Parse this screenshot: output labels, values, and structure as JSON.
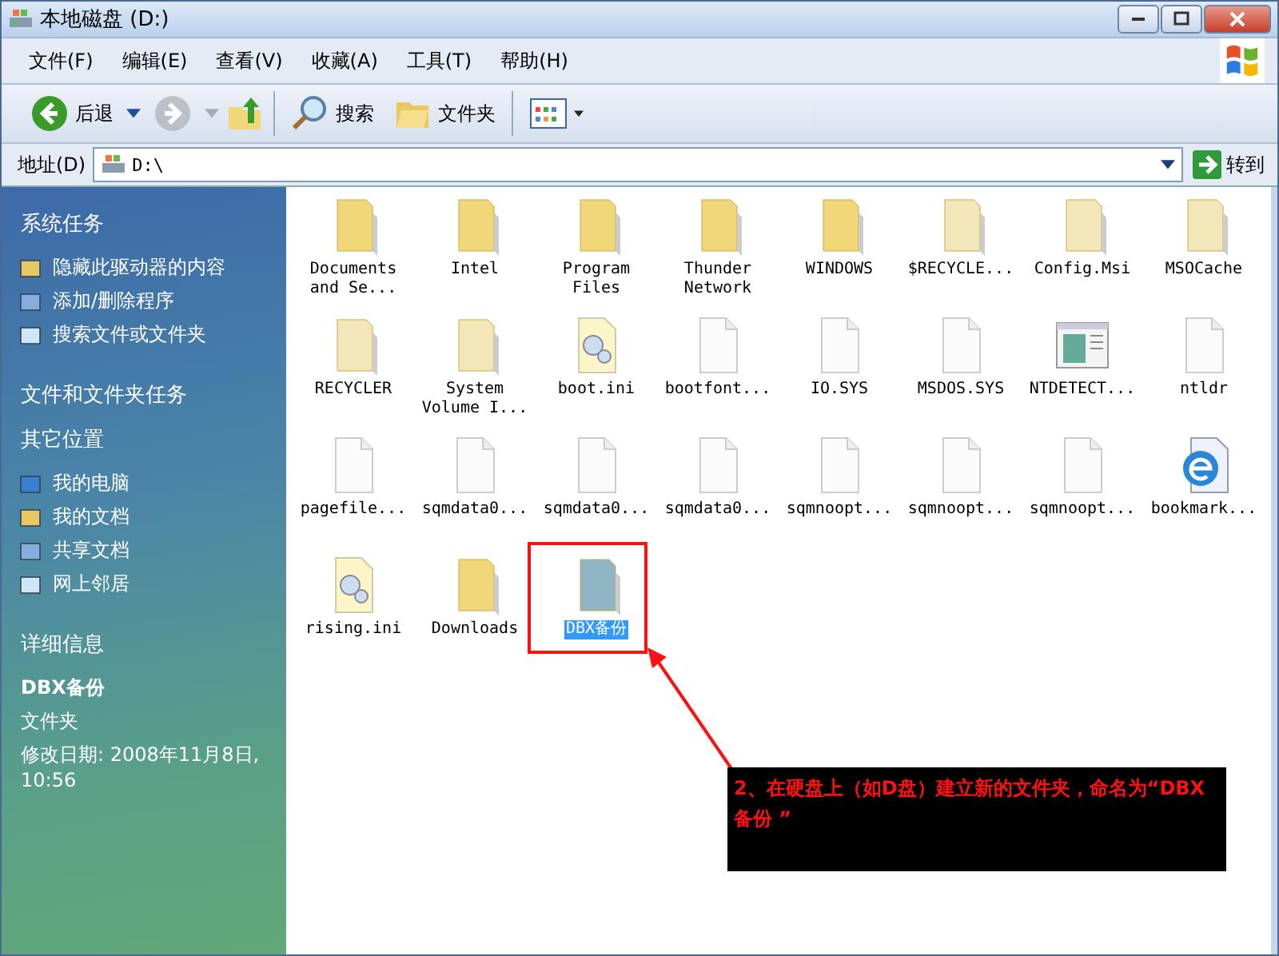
{
  "window": {
    "title": "本地磁盘 (D:)"
  },
  "menu": [
    "文件(F)",
    "编辑(E)",
    "查看(V)",
    "收藏(A)",
    "工具(T)",
    "帮助(H)"
  ],
  "toolbar": {
    "back": "后退",
    "forward_disabled": true,
    "search": "搜索",
    "folders": "文件夹"
  },
  "address": {
    "label": "地址(D)",
    "value": "D:\\",
    "go": "转到"
  },
  "sidebar": {
    "sections": [
      {
        "title": "系统任务",
        "items": [
          "隐藏此驱动器的内容",
          "添加/删除程序",
          "搜索文件或文件夹"
        ]
      },
      {
        "title": "文件和文件夹任务"
      },
      {
        "title": "其它位置",
        "items": [
          "我的电脑",
          "我的文档",
          "共享文档",
          "网上邻居"
        ]
      }
    ],
    "details": {
      "title": "详细信息",
      "name": "DBX备份",
      "type": "文件夹",
      "modified": "修改日期: 2008年11月8日, 10:56"
    }
  },
  "files": [
    {
      "name": "Documents and Se...",
      "kind": "folder",
      "hidden": false,
      "selected": false
    },
    {
      "name": "Intel",
      "kind": "folder",
      "hidden": false,
      "selected": false
    },
    {
      "name": "Program Files",
      "kind": "folder",
      "hidden": false,
      "selected": false
    },
    {
      "name": "Thunder Network",
      "kind": "folder",
      "hidden": false,
      "selected": false
    },
    {
      "name": "WINDOWS",
      "kind": "folder",
      "hidden": false,
      "selected": false
    },
    {
      "name": "$RECYCLE...",
      "kind": "folder",
      "hidden": true,
      "selected": false
    },
    {
      "name": "Config.Msi",
      "kind": "folder",
      "hidden": true,
      "selected": false
    },
    {
      "name": "MSOCache",
      "kind": "folder",
      "hidden": true,
      "selected": false
    },
    {
      "name": "RECYCLER",
      "kind": "folder",
      "hidden": true,
      "selected": false
    },
    {
      "name": "System Volume I...",
      "kind": "folder",
      "hidden": true,
      "selected": false
    },
    {
      "name": "boot.ini",
      "kind": "settings",
      "selected": false
    },
    {
      "name": "bootfont...",
      "kind": "file",
      "selected": false
    },
    {
      "name": "IO.SYS",
      "kind": "file",
      "selected": false
    },
    {
      "name": "MSDOS.SYS",
      "kind": "file",
      "selected": false
    },
    {
      "name": "NTDETECT...",
      "kind": "app",
      "selected": false
    },
    {
      "name": "ntldr",
      "kind": "file",
      "selected": false
    },
    {
      "name": "pagefile...",
      "kind": "file",
      "selected": false
    },
    {
      "name": "sqmdata0...",
      "kind": "file",
      "selected": false
    },
    {
      "name": "sqmdata0...",
      "kind": "file",
      "selected": false
    },
    {
      "name": "sqmdata0...",
      "kind": "file",
      "selected": false
    },
    {
      "name": "sqmnoopt...",
      "kind": "file",
      "selected": false
    },
    {
      "name": "sqmnoopt...",
      "kind": "file",
      "selected": false
    },
    {
      "name": "sqmnoopt...",
      "kind": "file",
      "selected": false
    },
    {
      "name": "bookmark...",
      "kind": "web",
      "selected": false
    },
    {
      "name": "rising.ini",
      "kind": "settings",
      "selected": false
    },
    {
      "name": "Downloads",
      "kind": "folder",
      "hidden": false,
      "selected": false
    },
    {
      "name": "DBX备份",
      "kind": "folder",
      "hidden": false,
      "selected": true
    }
  ],
  "annotation": {
    "text": "2、在硬盘上（如D盘）建立新的文件夹，命名为“DBX备份 ”"
  }
}
